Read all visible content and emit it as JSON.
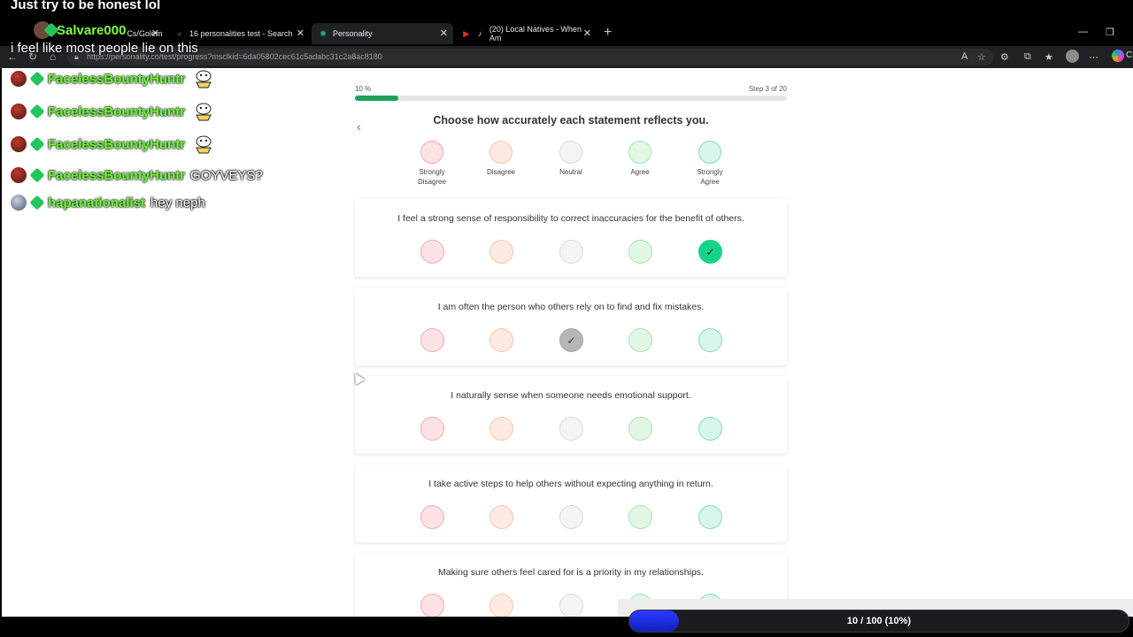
{
  "overlay": {
    "title": "Just try to be honest lol",
    "streamer_name": "Salvare000",
    "caption": "i feel like most people lie on this",
    "chat": [
      {
        "user": "FacelessBountyHuntr",
        "message": "",
        "emote": true
      },
      {
        "user": "FacelessBountyHuntr",
        "message": "",
        "emote": true
      },
      {
        "user": "FacelessBountyHuntr",
        "message": "",
        "emote": true
      },
      {
        "user": "FacelessBountyHuntr",
        "message": "GOYVEYS?",
        "emote": false
      },
      {
        "user": "hapanationalist",
        "message": "hey neph",
        "emote": false
      }
    ],
    "goal": {
      "label": "10 / 100 (10%)",
      "fraction": 0.1
    }
  },
  "browser": {
    "tabs": [
      {
        "label": "Cs/Golem",
        "icon": "avatar-icon"
      },
      {
        "label": "16 personalities test - Search",
        "icon": "search-icon"
      },
      {
        "label": "Personality",
        "icon": "gear-icon",
        "active": true
      },
      {
        "label": "(20) Local Natives - When Am",
        "icon": "youtube-icon"
      }
    ],
    "url": "https://personality.co/test/progress?msclkid=6da05802cec61c5adabc31c2a8ac8180",
    "copilot_label": "C"
  },
  "test": {
    "progress_text": "10 %",
    "progress_fraction": 0.1,
    "step_text": "Step 3 of 20",
    "heading": "Choose how accurately each statement reflects you.",
    "scale": [
      {
        "label": "Strongly Disagree",
        "fill": "#fbe3e5",
        "border": "#f2a9b0"
      },
      {
        "label": "Disagree",
        "fill": "#fdebe1",
        "border": "#f6c7ad"
      },
      {
        "label": "Neutral",
        "fill": "#f3f4f5",
        "border": "#d7d9dc"
      },
      {
        "label": "Agree",
        "fill": "#e3f7e6",
        "border": "#a6e3b1"
      },
      {
        "label": "Strongly Agree",
        "fill": "#d8f6ec",
        "border": "#7fdcbd"
      }
    ],
    "questions": [
      {
        "text": "I feel a strong sense of responsibility to correct inaccuracies for the benefit of others.",
        "selected": 4
      },
      {
        "text": "I am often the person who others rely on to find and fix mistakes.",
        "selected": 2
      },
      {
        "text": "I naturally sense when someone needs emotional support.",
        "selected": null
      },
      {
        "text": "I take active steps to help others without expecting anything in return.",
        "selected": null
      },
      {
        "text": "Making sure others feel cared for is a priority in my relationships.",
        "selected": null
      }
    ],
    "check_glyph": "✓"
  }
}
